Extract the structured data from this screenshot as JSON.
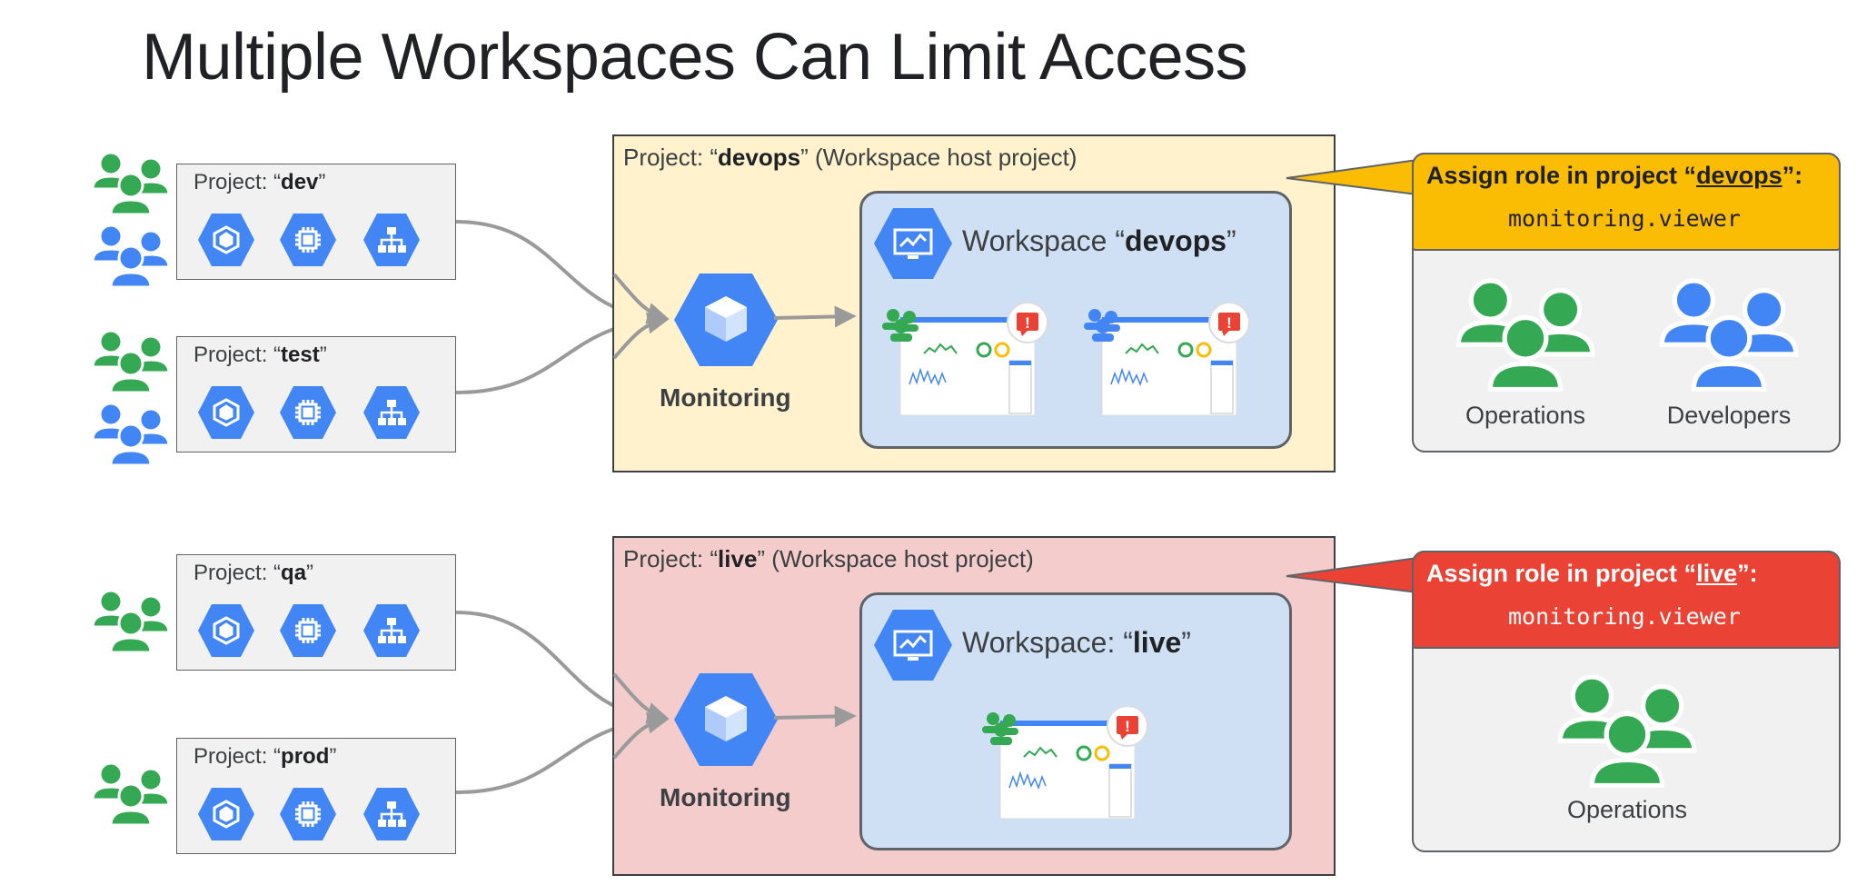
{
  "title": "Multiple Workspaces Can Limit Access",
  "projects": [
    {
      "prefix": "Project: “",
      "name": "dev",
      "suffix": "”"
    },
    {
      "prefix": "Project: “",
      "name": "test",
      "suffix": "”"
    },
    {
      "prefix": "Project: “",
      "name": "qa",
      "suffix": "”"
    },
    {
      "prefix": "Project: “",
      "name": "prod",
      "suffix": "”"
    }
  ],
  "hosts": [
    {
      "prefix": "Project: “",
      "name": "devops",
      "suffix": "” (Workspace host project)",
      "ws_prefix": "Workspace “",
      "ws_name": "devops",
      "ws_suffix": "”",
      "monitoring": "Monitoring",
      "bg": "#fff2cc"
    },
    {
      "prefix": "Project: “",
      "name": "live",
      "suffix": "” (Workspace host project)",
      "ws_prefix": "Workspace: “",
      "ws_name": "live",
      "ws_suffix": "”",
      "monitoring": "Monitoring",
      "bg": "#f4cccc"
    }
  ],
  "assign": [
    {
      "prefix": "Assign role in project “",
      "name": "devops",
      "suffix": "”:",
      "role": "monitoring.viewer",
      "color": "#fbbc04",
      "text_color": "#202124",
      "groups": [
        "Operations",
        "Developers"
      ]
    },
    {
      "prefix": "Assign role in project “",
      "name": "live",
      "suffix": "”:",
      "role": "monitoring.viewer",
      "color": "#ea4335",
      "text_color": "#ffffff",
      "groups": [
        "Operations"
      ]
    }
  ],
  "colors": {
    "green": "#34a853",
    "blue": "#4285f4",
    "arrow": "#9a9a9a",
    "alert": "#ea4335"
  },
  "icons": [
    "kubernetes-icon",
    "compute-engine-icon",
    "load-balancer-icon",
    "monitoring-icon",
    "dashboard-icon",
    "alert-icon",
    "people-icon"
  ]
}
